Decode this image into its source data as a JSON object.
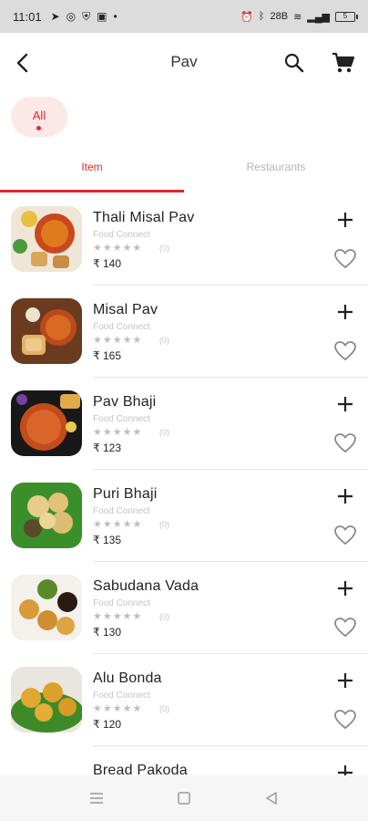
{
  "status": {
    "time": "11:01",
    "signal_text": "28B",
    "battery": "5"
  },
  "header": {
    "title": "Pav"
  },
  "filters": {
    "chip_label": "All"
  },
  "tabs": {
    "item": "Item",
    "restaurants": "Restaurants"
  },
  "items": [
    {
      "name": "Thali Misal Pav",
      "restaurant": "Food Connect",
      "stars": "★★★★★",
      "reviews": "(0)",
      "price": "₹ 140"
    },
    {
      "name": "Misal Pav",
      "restaurant": "Food Connect",
      "stars": "★★★★★",
      "reviews": "(0)",
      "price": "₹ 165"
    },
    {
      "name": "Pav Bhaji",
      "restaurant": "Food Connect",
      "stars": "★★★★★",
      "reviews": "(0)",
      "price": "₹ 123"
    },
    {
      "name": "Puri Bhaji",
      "restaurant": "Food Connect",
      "stars": "★★★★★",
      "reviews": "(0)",
      "price": "₹ 135"
    },
    {
      "name": "Sabudana Vada",
      "restaurant": "Food Connect",
      "stars": "★★★★★",
      "reviews": "(0)",
      "price": "₹ 130"
    },
    {
      "name": "Alu Bonda",
      "restaurant": "Food Connect",
      "stars": "★★★★★",
      "reviews": "(0)",
      "price": "₹ 120"
    },
    {
      "name": "Bread Pakoda",
      "restaurant": "",
      "stars": "",
      "reviews": "",
      "price": ""
    }
  ],
  "colors": {
    "accent": "#e0282e",
    "chip_bg": "#fde8e8"
  },
  "icons": [
    "back-arrow-icon",
    "search-icon",
    "cart-icon",
    "plus-icon",
    "heart-outline-icon",
    "menu-icon",
    "home-square-icon",
    "back-triangle-icon"
  ]
}
